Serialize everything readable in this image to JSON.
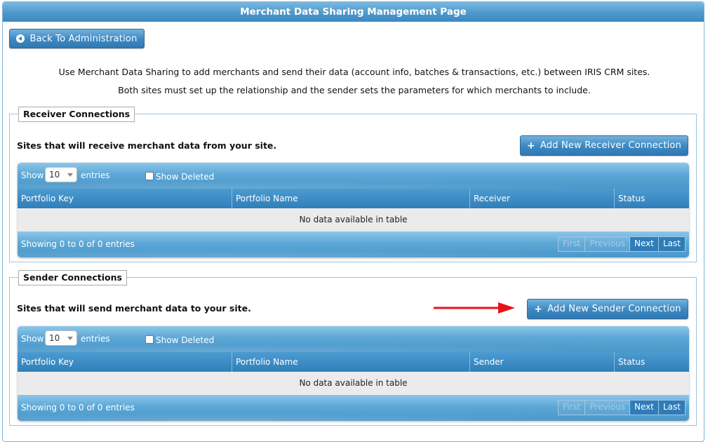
{
  "page": {
    "title": "Merchant Data Sharing Management Page",
    "back_button": "Back To Administration",
    "intro_line1": "Use Merchant Data Sharing to add merchants and send their data (account info, batches & transactions, etc.) between IRIS CRM sites.",
    "intro_line2": "Both sites must set up the relationship and the sender sets the parameters for which merchants to include."
  },
  "receiver": {
    "legend": "Receiver Connections",
    "description": "Sites that will receive merchant data from your site.",
    "add_button": "Add New Receiver Connection",
    "table": {
      "show_label": "Show",
      "page_length": "10",
      "entries_label": "entries",
      "show_deleted_label": "Show Deleted",
      "show_deleted_checked": false,
      "columns": [
        "Portfolio Key",
        "Portfolio Name",
        "Receiver",
        "Status"
      ],
      "empty_message": "No data available in table",
      "info": "Showing 0 to 0 of 0 entries",
      "pager": [
        "First",
        "Previous",
        "Next",
        "Last"
      ]
    }
  },
  "sender": {
    "legend": "Sender Connections",
    "description": "Sites that will send merchant data to your site.",
    "add_button": "Add New Sender Connection",
    "table": {
      "show_label": "Show",
      "page_length": "10",
      "entries_label": "entries",
      "show_deleted_label": "Show Deleted",
      "show_deleted_checked": false,
      "columns": [
        "Portfolio Key",
        "Portfolio Name",
        "Sender",
        "Status"
      ],
      "empty_message": "No data available in table",
      "info": "Showing 0 to 0 of 0 entries",
      "pager": [
        "First",
        "Previous",
        "Next",
        "Last"
      ]
    }
  },
  "colors": {
    "header_blue": "#4f98cb",
    "annotation_arrow": "#e8121a"
  },
  "icons": {
    "back": "circle-arrow-left-icon",
    "add": "plus-icon",
    "annotation": "red-arrow-right-icon"
  }
}
